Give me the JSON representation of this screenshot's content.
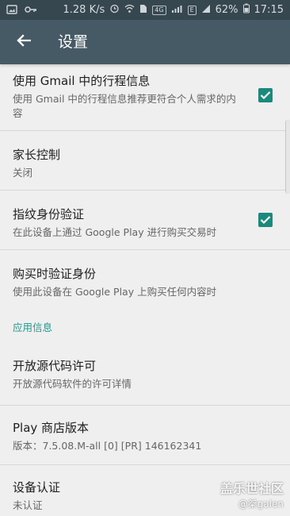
{
  "status_bar": {
    "speed": "1.28 K/s",
    "network": "4G",
    "carrier_badge": "E",
    "battery": "62%",
    "time": "17:15"
  },
  "app_bar": {
    "title": "设置"
  },
  "settings": [
    {
      "title": "使用 Gmail 中的行程信息",
      "summary": "使用 Gmail 中的行程信息推荐更符合个人需求的内容",
      "checked": true
    },
    {
      "title": "家长控制",
      "summary": "关闭",
      "checked": null
    },
    {
      "title": "指纹身份验证",
      "summary": "在此设备上通过 Google Play 进行购买交易时",
      "checked": true
    },
    {
      "title": "购买时验证身份",
      "summary": "使用此设备在 Google Play 上购买任何内容时",
      "checked": null
    }
  ],
  "section_header": "应用信息",
  "app_info": [
    {
      "title": "开放源代码许可",
      "summary": "开放源代码软件的许可详情"
    },
    {
      "title": "Play 商店版本",
      "summary": "版本：7.5.08.M-all [0] [PR] 146162341"
    },
    {
      "title": "设备认证",
      "summary": "未认证"
    }
  ],
  "watermark": {
    "title": "盖乐世社区",
    "user": "@桀galen"
  },
  "colors": {
    "status_bar": "#37474f",
    "app_bar": "#455a64",
    "accent": "#198a7c",
    "background": "#efefef"
  }
}
